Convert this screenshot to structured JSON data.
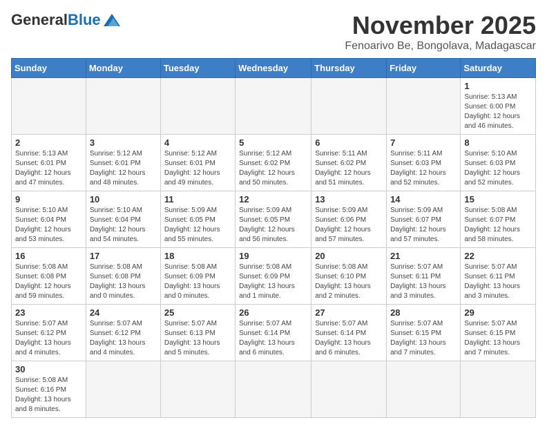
{
  "header": {
    "logo_general": "General",
    "logo_blue": "Blue",
    "month_title": "November 2025",
    "location": "Fenoarivo Be, Bongolava, Madagascar"
  },
  "days_of_week": [
    "Sunday",
    "Monday",
    "Tuesday",
    "Wednesday",
    "Thursday",
    "Friday",
    "Saturday"
  ],
  "weeks": [
    [
      {
        "day": "",
        "info": ""
      },
      {
        "day": "",
        "info": ""
      },
      {
        "day": "",
        "info": ""
      },
      {
        "day": "",
        "info": ""
      },
      {
        "day": "",
        "info": ""
      },
      {
        "day": "",
        "info": ""
      },
      {
        "day": "1",
        "info": "Sunrise: 5:13 AM\nSunset: 6:00 PM\nDaylight: 12 hours\nand 46 minutes."
      }
    ],
    [
      {
        "day": "2",
        "info": "Sunrise: 5:13 AM\nSunset: 6:01 PM\nDaylight: 12 hours\nand 47 minutes."
      },
      {
        "day": "3",
        "info": "Sunrise: 5:12 AM\nSunset: 6:01 PM\nDaylight: 12 hours\nand 48 minutes."
      },
      {
        "day": "4",
        "info": "Sunrise: 5:12 AM\nSunset: 6:01 PM\nDaylight: 12 hours\nand 49 minutes."
      },
      {
        "day": "5",
        "info": "Sunrise: 5:12 AM\nSunset: 6:02 PM\nDaylight: 12 hours\nand 50 minutes."
      },
      {
        "day": "6",
        "info": "Sunrise: 5:11 AM\nSunset: 6:02 PM\nDaylight: 12 hours\nand 51 minutes."
      },
      {
        "day": "7",
        "info": "Sunrise: 5:11 AM\nSunset: 6:03 PM\nDaylight: 12 hours\nand 52 minutes."
      },
      {
        "day": "8",
        "info": "Sunrise: 5:10 AM\nSunset: 6:03 PM\nDaylight: 12 hours\nand 52 minutes."
      }
    ],
    [
      {
        "day": "9",
        "info": "Sunrise: 5:10 AM\nSunset: 6:04 PM\nDaylight: 12 hours\nand 53 minutes."
      },
      {
        "day": "10",
        "info": "Sunrise: 5:10 AM\nSunset: 6:04 PM\nDaylight: 12 hours\nand 54 minutes."
      },
      {
        "day": "11",
        "info": "Sunrise: 5:09 AM\nSunset: 6:05 PM\nDaylight: 12 hours\nand 55 minutes."
      },
      {
        "day": "12",
        "info": "Sunrise: 5:09 AM\nSunset: 6:05 PM\nDaylight: 12 hours\nand 56 minutes."
      },
      {
        "day": "13",
        "info": "Sunrise: 5:09 AM\nSunset: 6:06 PM\nDaylight: 12 hours\nand 57 minutes."
      },
      {
        "day": "14",
        "info": "Sunrise: 5:09 AM\nSunset: 6:07 PM\nDaylight: 12 hours\nand 57 minutes."
      },
      {
        "day": "15",
        "info": "Sunrise: 5:08 AM\nSunset: 6:07 PM\nDaylight: 12 hours\nand 58 minutes."
      }
    ],
    [
      {
        "day": "16",
        "info": "Sunrise: 5:08 AM\nSunset: 6:08 PM\nDaylight: 12 hours\nand 59 minutes."
      },
      {
        "day": "17",
        "info": "Sunrise: 5:08 AM\nSunset: 6:08 PM\nDaylight: 13 hours\nand 0 minutes."
      },
      {
        "day": "18",
        "info": "Sunrise: 5:08 AM\nSunset: 6:09 PM\nDaylight: 13 hours\nand 0 minutes."
      },
      {
        "day": "19",
        "info": "Sunrise: 5:08 AM\nSunset: 6:09 PM\nDaylight: 13 hours\nand 1 minute."
      },
      {
        "day": "20",
        "info": "Sunrise: 5:08 AM\nSunset: 6:10 PM\nDaylight: 13 hours\nand 2 minutes."
      },
      {
        "day": "21",
        "info": "Sunrise: 5:07 AM\nSunset: 6:11 PM\nDaylight: 13 hours\nand 3 minutes."
      },
      {
        "day": "22",
        "info": "Sunrise: 5:07 AM\nSunset: 6:11 PM\nDaylight: 13 hours\nand 3 minutes."
      }
    ],
    [
      {
        "day": "23",
        "info": "Sunrise: 5:07 AM\nSunset: 6:12 PM\nDaylight: 13 hours\nand 4 minutes."
      },
      {
        "day": "24",
        "info": "Sunrise: 5:07 AM\nSunset: 6:12 PM\nDaylight: 13 hours\nand 4 minutes."
      },
      {
        "day": "25",
        "info": "Sunrise: 5:07 AM\nSunset: 6:13 PM\nDaylight: 13 hours\nand 5 minutes."
      },
      {
        "day": "26",
        "info": "Sunrise: 5:07 AM\nSunset: 6:14 PM\nDaylight: 13 hours\nand 6 minutes."
      },
      {
        "day": "27",
        "info": "Sunrise: 5:07 AM\nSunset: 6:14 PM\nDaylight: 13 hours\nand 6 minutes."
      },
      {
        "day": "28",
        "info": "Sunrise: 5:07 AM\nSunset: 6:15 PM\nDaylight: 13 hours\nand 7 minutes."
      },
      {
        "day": "29",
        "info": "Sunrise: 5:07 AM\nSunset: 6:15 PM\nDaylight: 13 hours\nand 7 minutes."
      }
    ],
    [
      {
        "day": "30",
        "info": "Sunrise: 5:08 AM\nSunset: 6:16 PM\nDaylight: 13 hours\nand 8 minutes."
      },
      {
        "day": "",
        "info": ""
      },
      {
        "day": "",
        "info": ""
      },
      {
        "day": "",
        "info": ""
      },
      {
        "day": "",
        "info": ""
      },
      {
        "day": "",
        "info": ""
      },
      {
        "day": "",
        "info": ""
      }
    ]
  ]
}
